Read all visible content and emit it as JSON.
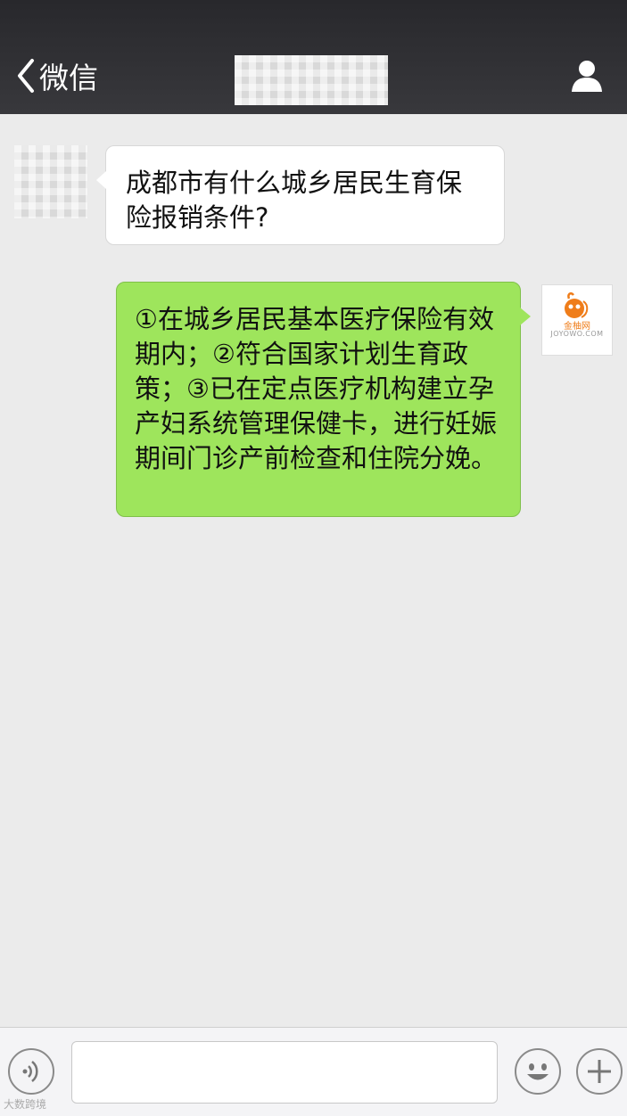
{
  "header": {
    "back_label": "微信",
    "contact_name_obscured": true
  },
  "messages": [
    {
      "direction": "incoming",
      "text": "成都市有什么城乡居民生育保险报销条件?"
    },
    {
      "direction": "outgoing",
      "text": "①在城乡居民基本医疗保险有效期内；②符合国家计划生育政策；③已在定点医疗机构建立孕产妇系统管理保健卡，进行妊娠期间门诊产前检查和住院分娩。",
      "avatar_brand": "JOYOWO.COM"
    }
  ],
  "colors": {
    "header_bg": "#2e2e32",
    "chat_bg": "#ebebeb",
    "outgoing_bubble": "#9ee55c",
    "incoming_bubble": "#ffffff",
    "logo_orange": "#ef7d1a"
  },
  "input": {
    "value": "",
    "placeholder": ""
  },
  "watermark": "大数跨境"
}
